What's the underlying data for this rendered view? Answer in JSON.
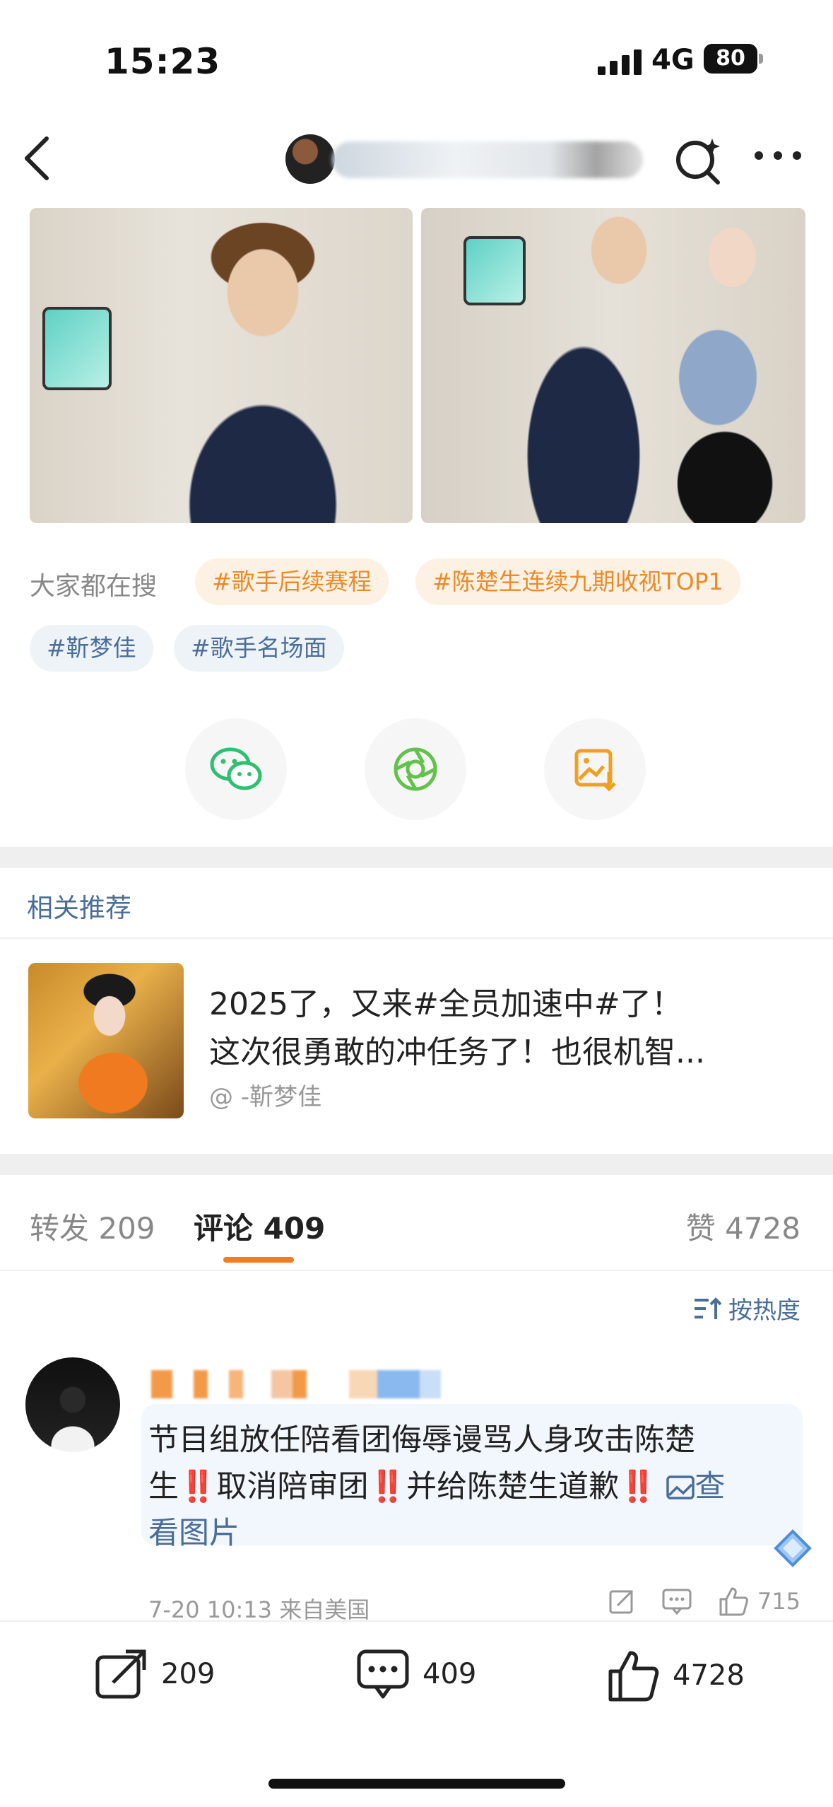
{
  "status_bar": {
    "time": "15:23",
    "network": "4G",
    "battery": "80"
  },
  "nav": {
    "back_icon": "chevron-left-icon",
    "search_icon": "search-sparkle-icon",
    "more_icon": "more-horizontal-icon"
  },
  "search": {
    "label": "大家都在搜",
    "tags": [
      "#歌手后续赛程",
      "#陈楚生连续九期收视TOP1",
      "#靳梦佳",
      "#歌手名场面"
    ]
  },
  "share": {
    "icons": [
      "wechat-icon",
      "moments-icon",
      "save-image-icon"
    ]
  },
  "related": {
    "title": "相关推荐",
    "line1": "2025了，又来#全员加速中#了！",
    "line2": "这次很勇敢的冲任务了！也很机智...",
    "author": "@ -靳梦佳"
  },
  "tabs": {
    "repost": "转发 209",
    "comment": "评论 409",
    "like": "赞 4728"
  },
  "sort_label": "按热度",
  "comment": {
    "line1": "节目组放任陪看团侮辱谩骂人身攻击陈楚",
    "line2_a": "生",
    "line2_b": "取消陪审团",
    "line2_c": "并给陈楚生道歉",
    "alarm": "‼️",
    "view_image": "查",
    "line3": "看图片",
    "time_location": "7-20 10:13 来自美国",
    "likes": "715"
  },
  "bottom_bar": {
    "repost_count": "209",
    "comment_count": "409",
    "like_count": "4728"
  },
  "colors": {
    "accent_orange": "#f07c24",
    "link_blue": "#4a6e98",
    "tag_orange": "#e98b2a"
  }
}
